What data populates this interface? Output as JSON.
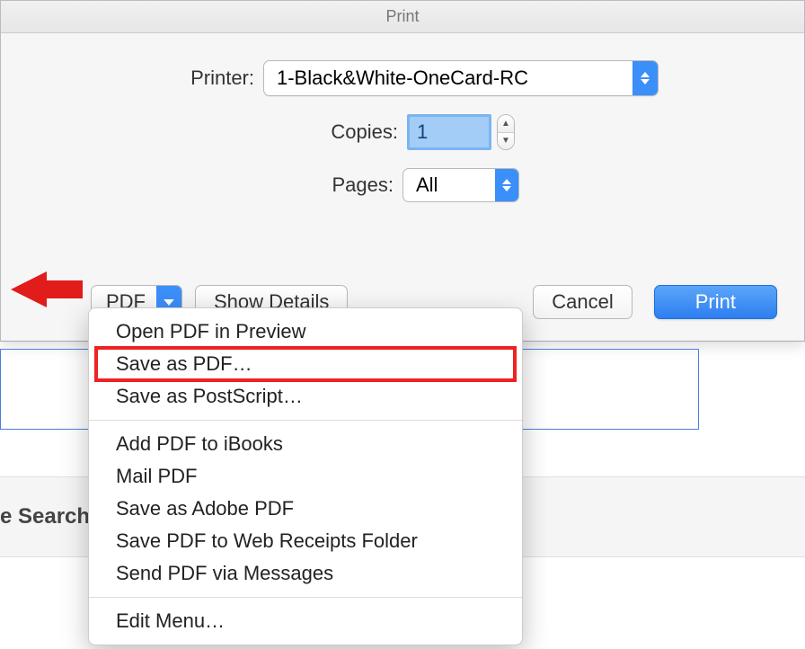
{
  "title": "Print",
  "labels": {
    "printer": "Printer:",
    "copies": "Copies:",
    "pages": "Pages:"
  },
  "printer": {
    "value": "1-Black&White-OneCard-RC"
  },
  "copies": {
    "value": "1"
  },
  "pages": {
    "value": "All"
  },
  "buttons": {
    "pdf": "PDF",
    "show_details": "Show Details",
    "cancel": "Cancel",
    "print": "Print"
  },
  "pdf_menu": {
    "items": [
      "Open PDF in Preview",
      "Save as PDF…",
      "Save as PostScript…"
    ],
    "items2": [
      "Add PDF to iBooks",
      "Mail PDF",
      "Save as Adobe PDF",
      "Save PDF to Web Receipts Folder",
      "Send PDF via Messages"
    ],
    "items3": [
      "Edit Menu…"
    ],
    "highlighted_index": 1
  },
  "background": {
    "search_label": "e Search"
  },
  "accent_color": "#3b8ff9",
  "highlight_color": "#e22222"
}
